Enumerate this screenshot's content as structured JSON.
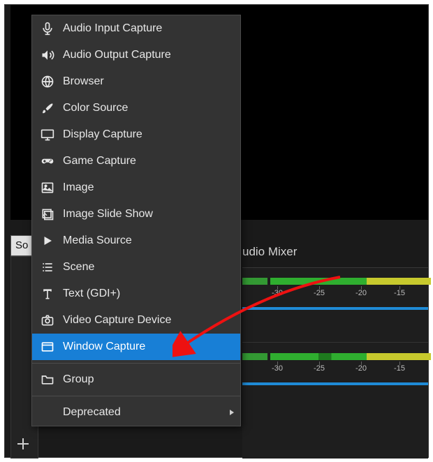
{
  "panels": {
    "left_tab_truncated": "So",
    "audio_mixer_title": "udio Mixer",
    "ruler_labels": [
      "-30",
      "-25",
      "-20",
      "-15"
    ]
  },
  "menu": {
    "items": [
      {
        "icon": "mic",
        "label": "Audio Input Capture"
      },
      {
        "icon": "speaker",
        "label": "Audio Output Capture"
      },
      {
        "icon": "globe",
        "label": "Browser"
      },
      {
        "icon": "brush",
        "label": "Color Source"
      },
      {
        "icon": "monitor",
        "label": "Display Capture"
      },
      {
        "icon": "gamepad",
        "label": "Game Capture"
      },
      {
        "icon": "image",
        "label": "Image"
      },
      {
        "icon": "slides",
        "label": "Image Slide Show"
      },
      {
        "icon": "play",
        "label": "Media Source"
      },
      {
        "icon": "list",
        "label": "Scene"
      },
      {
        "icon": "text",
        "label": "Text (GDI+)"
      },
      {
        "icon": "camera",
        "label": "Video Capture Device"
      },
      {
        "icon": "window",
        "label": "Window Capture",
        "highlight": true
      }
    ],
    "group": {
      "icon": "folder",
      "label": "Group"
    },
    "deprecated": {
      "label": "Deprecated",
      "submenu": true
    }
  }
}
